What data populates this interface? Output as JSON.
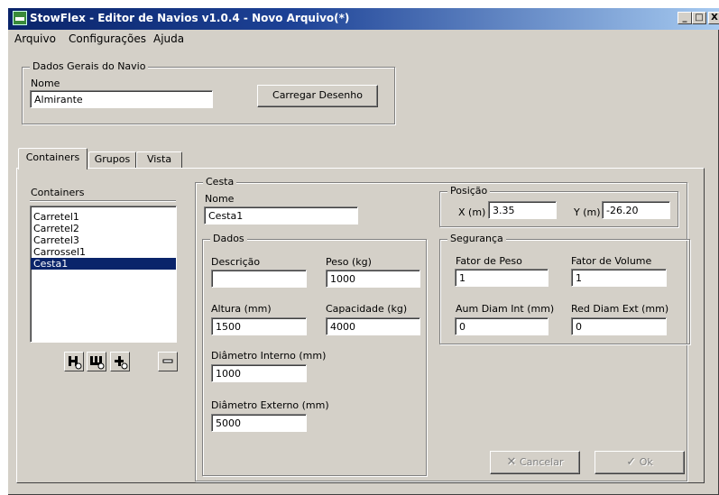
{
  "window": {
    "title": "StowFlex - Editor de Navios v1.0.4 - Novo Arquivo(*)"
  },
  "caption_buttons": {
    "minimize": "_",
    "maximize": "□",
    "close": "X"
  },
  "menu": [
    {
      "label": "Arquivo"
    },
    {
      "label": "Configurações"
    },
    {
      "label": "Ajuda"
    }
  ],
  "dados_gerais": {
    "legend": "Dados Gerais do Navio",
    "nome_label": "Nome",
    "nome_value": "Almirante",
    "carregar_label": "Carregar Desenho"
  },
  "tabs": [
    {
      "label": "Containers",
      "active": true
    },
    {
      "label": "Grupos",
      "active": false
    },
    {
      "label": "Vista",
      "active": false
    }
  ],
  "containers_list": {
    "title": "Containers",
    "items": [
      {
        "label": "Carretel1",
        "selected": false
      },
      {
        "label": "Carretel2",
        "selected": false
      },
      {
        "label": "Carretel3",
        "selected": false
      },
      {
        "label": "Carrossel1",
        "selected": false
      },
      {
        "label": "Cesta1",
        "selected": true
      }
    ],
    "tool_icons": [
      "add-container-icon",
      "add-group-icon",
      "insert-icon",
      "remove-icon"
    ]
  },
  "cesta": {
    "legend": "Cesta",
    "nome_label": "Nome",
    "nome_value": "Cesta1"
  },
  "dados": {
    "legend": "Dados",
    "descricao_label": "Descrição",
    "descricao_value": "",
    "peso_label": "Peso (kg)",
    "peso_value": "1000",
    "altura_label": "Altura (mm)",
    "altura_value": "1500",
    "capacidade_label": "Capacidade (kg)",
    "capacidade_value": "4000",
    "diam_int_label": "Diâmetro Interno (mm)",
    "diam_int_value": "1000",
    "diam_ext_label": "Diâmetro Externo (mm)",
    "diam_ext_value": "5000"
  },
  "posicao": {
    "legend": "Posição",
    "x_label": "X (m)",
    "x_value": "3.35",
    "y_label": "Y (m)",
    "y_value": "-26.20"
  },
  "seguranca": {
    "legend": "Segurança",
    "fator_peso_label": "Fator de Peso",
    "fator_peso_value": "1",
    "fator_volume_label": "Fator de Volume",
    "fator_volume_value": "1",
    "aum_diam_label": "Aum Diam Int (mm)",
    "aum_diam_value": "0",
    "red_diam_label": "Red Diam Ext (mm)",
    "red_diam_value": "0"
  },
  "actions": {
    "cancelar_label": "Cancelar",
    "ok_label": "Ok"
  }
}
